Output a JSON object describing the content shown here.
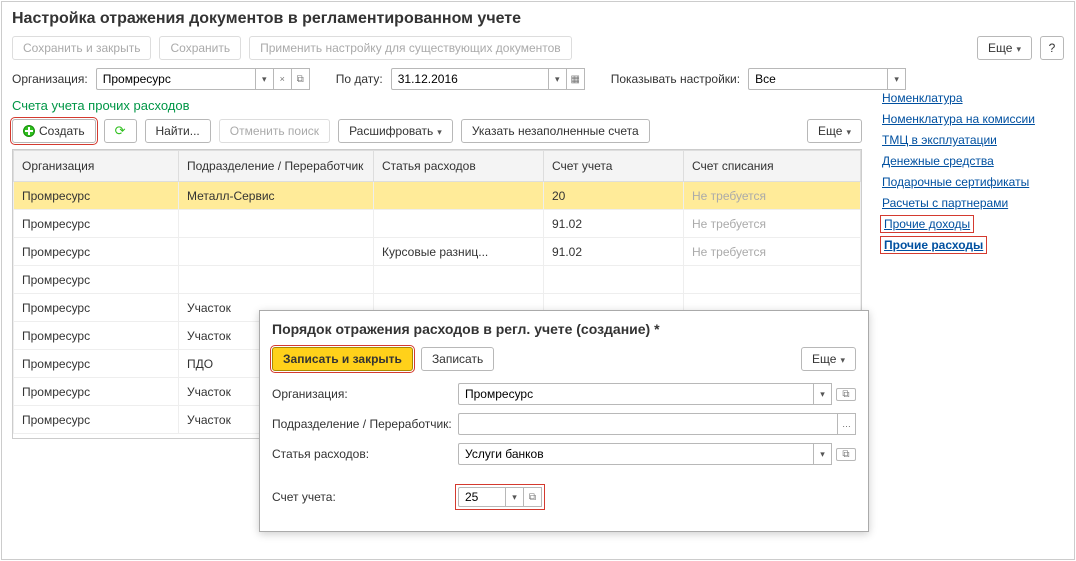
{
  "page_title": "Настройка отражения документов в регламентированном учете",
  "toolbar": {
    "save_close": "Сохранить и закрыть",
    "save": "Сохранить",
    "apply": "Применить настройку для существующих документов",
    "more": "Еще",
    "help": "?"
  },
  "filters": {
    "org_label": "Организация:",
    "org_value": "Промресурс",
    "to_date_label": "По дату:",
    "to_date_value": "31.12.2016",
    "show_label": "Показывать настройки:",
    "show_value": "Все"
  },
  "section_title": "Счета учета прочих расходов",
  "sub_toolbar": {
    "create": "Создать",
    "find": "Найти...",
    "cancel_search": "Отменить поиск",
    "decrypt": "Расшифровать",
    "fill_empty": "Указать незаполненные счета",
    "more": "Еще"
  },
  "columns": {
    "org": "Организация",
    "dept": "Подразделение / Переработчик",
    "item": "Статья расходов",
    "acct": "Счет учета",
    "woff": "Счет списания"
  },
  "rows": [
    {
      "org": "Промресурс",
      "dept": "Металл-Сервис",
      "item": "",
      "acct": "20",
      "woff": "Не требуется"
    },
    {
      "org": "Промресурс",
      "dept": "",
      "item": "",
      "acct": "91.02",
      "woff": "Не требуется"
    },
    {
      "org": "Промресурс",
      "dept": "",
      "item": "Курсовые разниц...",
      "acct": "91.02",
      "woff": "Не требуется"
    },
    {
      "org": "Промресурс",
      "dept": "",
      "item": "",
      "acct": "",
      "woff": ""
    },
    {
      "org": "Промресурс",
      "dept": "Участок",
      "item": "",
      "acct": "",
      "woff": ""
    },
    {
      "org": "Промресурс",
      "dept": "Участок",
      "item": "",
      "acct": "",
      "woff": ""
    },
    {
      "org": "Промресурс",
      "dept": "ПДО",
      "item": "",
      "acct": "",
      "woff": ""
    },
    {
      "org": "Промресурс",
      "dept": "Участок",
      "item": "",
      "acct": "",
      "woff": ""
    },
    {
      "org": "Промресурс",
      "dept": "Участок",
      "item": "",
      "acct": "",
      "woff": ""
    }
  ],
  "links": {
    "nomenclature": "Номенклатура",
    "commission": "Номенклатура на комиссии",
    "tmc": "ТМЦ в эксплуатации",
    "cash": "Денежные средства",
    "gift": "Подарочные сертификаты",
    "partners": "Расчеты с партнерами",
    "other_income": "Прочие доходы",
    "other_expense": "Прочие расходы"
  },
  "dialog": {
    "title": "Порядок отражения расходов в регл. учете (создание) *",
    "save_close": "Записать и закрыть",
    "save": "Записать",
    "more": "Еще",
    "org_label": "Организация:",
    "org_value": "Промресурс",
    "dept_label": "Подразделение / Переработчик:",
    "dept_value": "",
    "item_label": "Статья расходов:",
    "item_value": "Услуги банков",
    "acct_label": "Счет учета:",
    "acct_value": "25"
  }
}
